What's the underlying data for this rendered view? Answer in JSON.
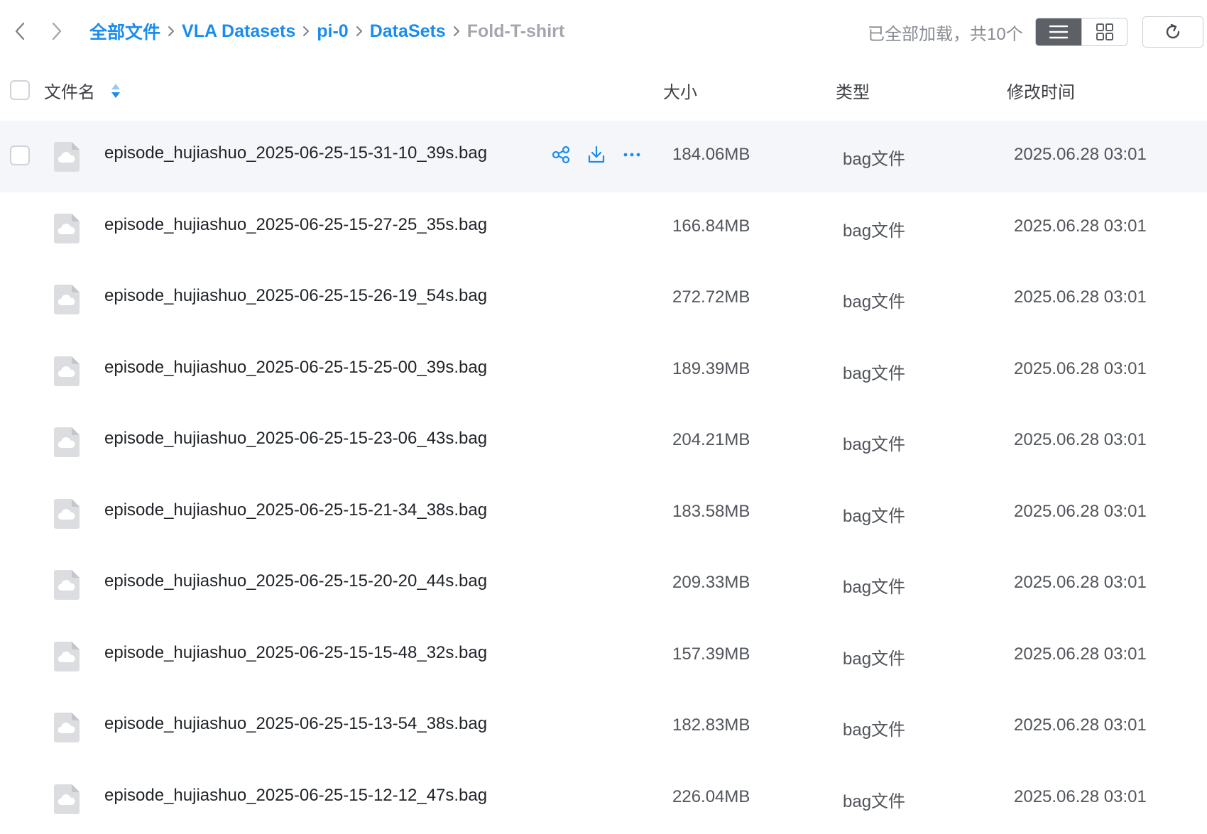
{
  "breadcrumb": {
    "items": [
      "全部文件",
      "VLA Datasets",
      "pi-0",
      "DataSets"
    ],
    "current": "Fold-T-shirt"
  },
  "status": {
    "load_text": "已全部加载，共10个"
  },
  "view": {
    "mode": "list"
  },
  "icons": {
    "back": "chevron-left-icon",
    "forward": "chevron-right-icon",
    "list": "list-view-icon",
    "grid": "grid-view-icon",
    "refresh": "refresh-icon",
    "sort": "sort-icon",
    "file": "cloud-file-icon",
    "share": "share-icon",
    "download": "download-icon",
    "more": "more-icon"
  },
  "colors": {
    "link": "#1a8cf0",
    "crumb_current": "#a3a7ad",
    "hover_row": "#f4f6fa",
    "view_active": "#5d6167"
  },
  "table": {
    "headers": {
      "name": "文件名",
      "size": "大小",
      "type": "类型",
      "modified": "修改时间"
    },
    "hovered_row": 0,
    "rows": [
      {
        "name": "episode_hujiashuo_2025-06-25-15-31-10_39s.bag",
        "size": "184.06MB",
        "type": "bag文件",
        "modified": "2025.06.28 03:01"
      },
      {
        "name": "episode_hujiashuo_2025-06-25-15-27-25_35s.bag",
        "size": "166.84MB",
        "type": "bag文件",
        "modified": "2025.06.28 03:01"
      },
      {
        "name": "episode_hujiashuo_2025-06-25-15-26-19_54s.bag",
        "size": "272.72MB",
        "type": "bag文件",
        "modified": "2025.06.28 03:01"
      },
      {
        "name": "episode_hujiashuo_2025-06-25-15-25-00_39s.bag",
        "size": "189.39MB",
        "type": "bag文件",
        "modified": "2025.06.28 03:01"
      },
      {
        "name": "episode_hujiashuo_2025-06-25-15-23-06_43s.bag",
        "size": "204.21MB",
        "type": "bag文件",
        "modified": "2025.06.28 03:01"
      },
      {
        "name": "episode_hujiashuo_2025-06-25-15-21-34_38s.bag",
        "size": "183.58MB",
        "type": "bag文件",
        "modified": "2025.06.28 03:01"
      },
      {
        "name": "episode_hujiashuo_2025-06-25-15-20-20_44s.bag",
        "size": "209.33MB",
        "type": "bag文件",
        "modified": "2025.06.28 03:01"
      },
      {
        "name": "episode_hujiashuo_2025-06-25-15-15-48_32s.bag",
        "size": "157.39MB",
        "type": "bag文件",
        "modified": "2025.06.28 03:01"
      },
      {
        "name": "episode_hujiashuo_2025-06-25-15-13-54_38s.bag",
        "size": "182.83MB",
        "type": "bag文件",
        "modified": "2025.06.28 03:01"
      },
      {
        "name": "episode_hujiashuo_2025-06-25-15-12-12_47s.bag",
        "size": "226.04MB",
        "type": "bag文件",
        "modified": "2025.06.28 03:01"
      }
    ]
  }
}
